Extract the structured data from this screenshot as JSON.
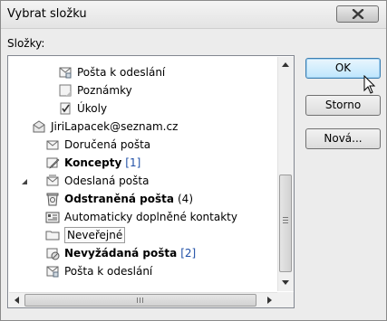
{
  "window": {
    "title": "Vybrat složku"
  },
  "folders_label": "Složky:",
  "tree": [
    {
      "label": "Pošta k odeslání",
      "icon": "outbox-icon",
      "bold": false,
      "count": ""
    },
    {
      "label": "Poznámky",
      "icon": "notes-icon",
      "bold": false,
      "count": ""
    },
    {
      "label": "Úkoly",
      "icon": "tasks-icon",
      "bold": false,
      "count": ""
    },
    {
      "label": "JiriLapacek@seznam.cz",
      "icon": "mailbox-icon",
      "bold": false,
      "count": ""
    },
    {
      "label": "Doručená pošta",
      "icon": "inbox-icon",
      "bold": false,
      "count": ""
    },
    {
      "label": "Koncepty",
      "icon": "drafts-icon",
      "bold": true,
      "count": "[1]"
    },
    {
      "label": "Odeslaná pošta",
      "icon": "sent-icon",
      "bold": false,
      "count": ""
    },
    {
      "label": "Odstraněná pošta",
      "icon": "deleted-icon",
      "bold": true,
      "count": "(4)"
    },
    {
      "label": "Automaticky doplněné kontakty",
      "icon": "contacts-icon",
      "bold": false,
      "count": ""
    },
    {
      "label": "Neveřejné",
      "icon": "folder-icon",
      "bold": false,
      "count": "",
      "selected": true
    },
    {
      "label": "Nevyžádaná pošta",
      "icon": "junk-icon",
      "bold": true,
      "count": "[2]"
    },
    {
      "label": "Pošta k odeslání",
      "icon": "outbox-icon",
      "bold": false,
      "count": ""
    }
  ],
  "buttons": {
    "ok": "OK",
    "cancel": "Storno",
    "new": "Nová..."
  },
  "colors": {
    "count_blue": "#1f4fa6",
    "dialog_bg": "#ececec"
  }
}
